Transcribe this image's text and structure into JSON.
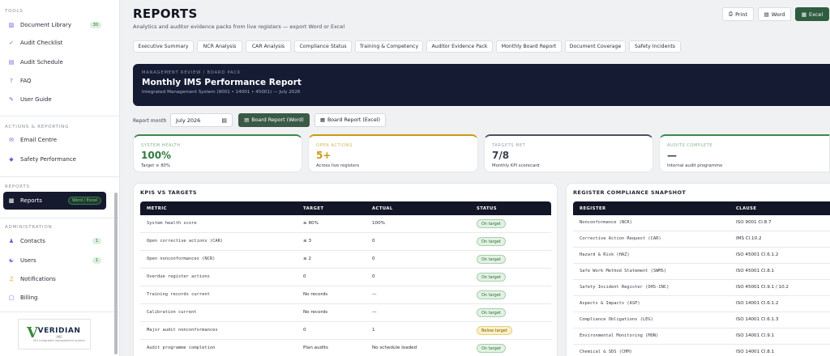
{
  "sidebar": {
    "sections": [
      {
        "heading": "TOOLS",
        "items": [
          {
            "label": "Document Library",
            "icon": "book-icon",
            "badge": "30"
          },
          {
            "label": "Audit Checklist",
            "icon": "check-icon",
            "badge": null
          },
          {
            "label": "Audit Schedule",
            "icon": "calendar-icon",
            "badge": null
          },
          {
            "label": "FAQ",
            "icon": "question-icon",
            "badge": null
          },
          {
            "label": "User Guide",
            "icon": "guide-icon",
            "badge": null
          }
        ]
      },
      {
        "heading": "ACTIONS & REPORTING",
        "items": [
          {
            "label": "Email Centre",
            "icon": "mail-icon",
            "badge": null
          },
          {
            "label": "Safety Performance",
            "icon": "shield-icon",
            "badge": null
          }
        ]
      },
      {
        "heading": "REPORTS",
        "items": [
          {
            "label": "Reports",
            "icon": "chart-icon",
            "badge": "Word / Excel",
            "active": true
          }
        ]
      },
      {
        "heading": "ADMINISTRATION",
        "items": [
          {
            "label": "Contacts",
            "icon": "contacts-icon",
            "badge": "1"
          },
          {
            "label": "Users",
            "icon": "users-icon",
            "badge": "1"
          },
          {
            "label": "Notifications",
            "icon": "bell-icon",
            "badge": null
          },
          {
            "label": "Billing",
            "icon": "billing-icon",
            "badge": null
          }
        ]
      }
    ],
    "logo": {
      "text": "VERIDIAN",
      "sub": "IMS",
      "tagline": "ISO integrated management system"
    }
  },
  "header": {
    "title": "REPORTS",
    "subtitle": "Analytics and auditor evidence packs from live registers — export Word or Excel",
    "buttons": {
      "print": "Print",
      "word": "Word",
      "excel": "Excel"
    }
  },
  "tabs": [
    "Executive Summary",
    "NCR Analysis",
    "CAR Analysis",
    "Compliance Status",
    "Training & Competency",
    "Auditor Evidence Pack",
    "Monthly Board Report",
    "Document Coverage",
    "Safety Incidents"
  ],
  "banner": {
    "kicker": "MANAGEMENT REVIEW / BOARD PACK",
    "title": "Monthly IMS Performance Report",
    "subtitle": "Integrated Management System (9001 • 14001 • 45001) — July 2026"
  },
  "report_month": {
    "label": "Report month",
    "value": "July 2026",
    "word_button": "Board Report (Word)",
    "excel_button": "Board Report (Excel)"
  },
  "kpis": [
    {
      "label": "SYSTEM HEALTH",
      "value": "100%",
      "note": "Target ≥ 80%",
      "color": "#3a8a4a"
    },
    {
      "label": "OPEN ACTIONS",
      "value": "5+",
      "note": "Across live registers",
      "color": "#c99a12"
    },
    {
      "label": "TARGETS MET",
      "value": "7/8",
      "note": "Monthly KPI scorecard",
      "color": "#4a5060"
    },
    {
      "label": "AUDITS COMPLETE",
      "value": "—",
      "note": "Internal audit programme",
      "color": "#3a8a4a"
    }
  ],
  "kpi_table": {
    "title": "KPIS VS TARGETS",
    "headers": [
      "METRIC",
      "TARGET",
      "ACTUAL",
      "STATUS"
    ],
    "rows": [
      {
        "metric": "System health score",
        "target": "≥ 80%",
        "actual": "100%",
        "status": "On target",
        "ok": true
      },
      {
        "metric": "Open corrective actions (CAR)",
        "target": "≤ 3",
        "actual": "0",
        "status": "On target",
        "ok": true
      },
      {
        "metric": "Open nonconformances (NCR)",
        "target": "≤ 2",
        "actual": "0",
        "status": "On target",
        "ok": true
      },
      {
        "metric": "Overdue register actions",
        "target": "0",
        "actual": "0",
        "status": "On target",
        "ok": true
      },
      {
        "metric": "Training records current",
        "target": "No records",
        "actual": "—",
        "status": "On target",
        "ok": true
      },
      {
        "metric": "Calibration current",
        "target": "No records",
        "actual": "—",
        "status": "On target",
        "ok": true
      },
      {
        "metric": "Major audit nonconformances",
        "target": "0",
        "actual": "1",
        "status": "Below target",
        "ok": false
      },
      {
        "metric": "Audit programme completion",
        "target": "Plan audits",
        "actual": "No schedule loaded",
        "status": "On target",
        "ok": true
      }
    ]
  },
  "compliance_table": {
    "title": "REGISTER COMPLIANCE SNAPSHOT",
    "headers": [
      "REGISTER",
      "CLAUSE"
    ],
    "rows": [
      {
        "register": "Nonconformance (NCR)",
        "clause": "ISO 9001 Cl.8.7"
      },
      {
        "register": "Corrective Action Request (CAR)",
        "clause": "IMS Cl.10.2"
      },
      {
        "register": "Hazard & Risk (HAZ)",
        "clause": "ISO 45001 Cl.6.1.2"
      },
      {
        "register": "Safe Work Method Statement (SWMS)",
        "clause": "ISO 45001 Cl.8.1"
      },
      {
        "register": "Safety Incident Register (OHS-INC)",
        "clause": "ISO 45001 Cl.9.1 / 10.2"
      },
      {
        "register": "Aspects & Impacts (ASP)",
        "clause": "ISO 14001 Cl.6.1.2"
      },
      {
        "register": "Compliance Obligations (LEG)",
        "clause": "ISO 14001 Cl.6.1.3"
      },
      {
        "register": "Environmental Monitoring (MON)",
        "clause": "ISO 14001 Cl.9.1"
      },
      {
        "register": "Chemical & SDS (CHM)",
        "clause": "ISO 14001 Cl.8.1"
      }
    ]
  }
}
